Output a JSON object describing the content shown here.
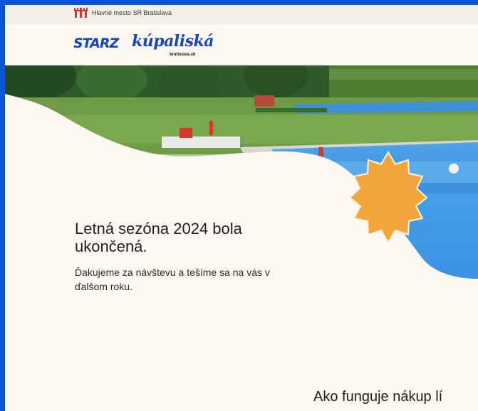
{
  "topbar": {
    "city_label": "Hlavné mesto SR Bratislava"
  },
  "header": {
    "starz_logo_text": "STARZ",
    "kupaliska_logo_text": "kúpaliská",
    "kupaliska_sub": "bratislava.sk"
  },
  "main": {
    "headline": "Letná sezóna 2024 bola ukončená.",
    "subtext": "Ďakujeme za návštevu a tešíme sa na vás v ďalšom roku.",
    "section_heading": "Ako funguje nákup lí"
  },
  "colors": {
    "page_border": "#0a56d6",
    "background": "#fdf8f2",
    "logo_blue": "#1545b8",
    "badge_orange": "#f0a63c",
    "city_red": "#d8322a"
  },
  "icons": {
    "city": "bratislava-coat-of-arms-icon",
    "badge": "star-badge-icon"
  }
}
